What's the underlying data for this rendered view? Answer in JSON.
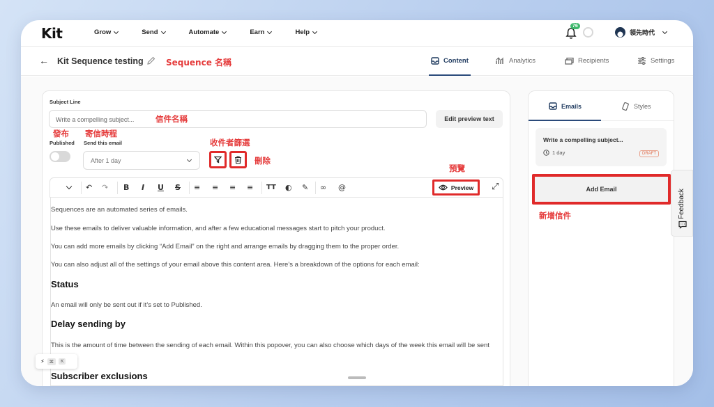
{
  "app": {
    "logo": "Kit"
  },
  "nav": {
    "items": [
      "Grow",
      "Send",
      "Automate",
      "Earn",
      "Help"
    ],
    "notification_count": "76",
    "account_name": "領先時代"
  },
  "subheader": {
    "title": "Kit Sequence testing",
    "title_annotation": "Sequence 名稱",
    "tabs": [
      {
        "label": "Content",
        "icon": "inbox-icon",
        "active": true
      },
      {
        "label": "Analytics",
        "icon": "chart-icon",
        "active": false
      },
      {
        "label": "Recipients",
        "icon": "recipients-icon",
        "active": false
      },
      {
        "label": "Settings",
        "icon": "sliders-icon",
        "active": false
      }
    ]
  },
  "editor": {
    "subject_label": "Subject Line",
    "subject_placeholder": "Write a compelling subject...",
    "subject_annotation": "信件名稱",
    "edit_preview_text": "Edit preview text",
    "published_annotation": "發布",
    "published_label": "Published",
    "send_annotation": "寄信時程",
    "send_label": "Send this email",
    "delay_value": "After 1 day",
    "filter_annotation": "收件者篩選",
    "delete_annotation": "刪除",
    "preview_annotation": "預覽",
    "preview_label": "Preview",
    "paragraphs": [
      "Sequences are an automated series of emails.",
      "Use these emails to deliver valuable information, and after a few educational messages start to pitch your product.",
      "You can add more emails by clicking “Add Email” on the right and arrange emails by dragging them to the proper order.",
      "You can also adjust all of the settings of your email above this content area. Here’s a breakdown of the options for each email:"
    ],
    "heading_status": "Status",
    "status_text": "An email will only be sent out if it’s set to Published.",
    "heading_delay": "Delay sending by",
    "delay_text": "This is the amount of time between the sending of each email. Within this popover, you can also choose which days of the week this email will be sent on.",
    "heading_exclusions": "Subscriber exclusions",
    "shortcut_keys": [
      "⌘",
      "K"
    ]
  },
  "sidebar": {
    "tabs": [
      {
        "label": "Emails",
        "icon": "inbox-icon",
        "active": true
      },
      {
        "label": "Styles",
        "icon": "styles-icon",
        "active": false
      }
    ],
    "email_card": {
      "title": "Write a compelling subject...",
      "delay": "1 day",
      "status": "DRAFT"
    },
    "add_email_label": "Add Email",
    "add_email_annotation": "新增信件",
    "feedback_label": "Feedback"
  },
  "colors": {
    "annotation": "#e53b3b",
    "accent": "#2a4a7a",
    "badge": "#3fb86c"
  }
}
